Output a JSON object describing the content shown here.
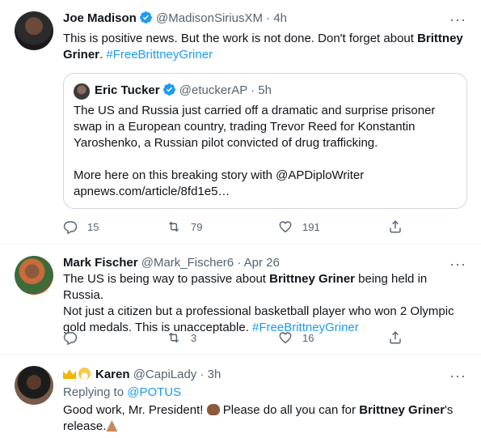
{
  "tweets": [
    {
      "name": "Joe Madison",
      "handle": "@MadisonSiriusXM",
      "time": "4h",
      "text_1": "This is positive news. But the work is not done. Don't forget about ",
      "text_bold_1": "Brittney",
      "text_bold_2": "Griner",
      "text_2": ". ",
      "hashtag": "#FreeBrittneyGriner",
      "quote": {
        "name": "Eric Tucker",
        "handle": "@etuckerAP",
        "time": "5h",
        "line_1": "The US and Russia just carried off a dramatic and surprise prisoner",
        "line_2": "swap in a European country, trading Trevor Reed for Konstantin",
        "line_3": "Yaroshenko, a Russian pilot convicted of drug trafficking.",
        "line_4": "More here on this breaking story with @APDiploWriter",
        "line_5": "apnews.com/article/8fd1e5…"
      },
      "replies": "15",
      "retweets": "79",
      "likes": "191"
    },
    {
      "name": "Mark Fischer",
      "handle": "@Mark_Fischer6",
      "time": "Apr 26",
      "line_1a": "The US is being way to passive about ",
      "line_1b": "Brittney Griner",
      "line_1c": " being held in Russia.",
      "line_2": "Not just a citizen but a professional basketball player who won 2 Olympic",
      "line_3": "gold medals. This is unacceptable. ",
      "hashtag": "#FreeBrittneyGriner",
      "replies": "",
      "retweets": "3",
      "likes": "16"
    },
    {
      "name": "Karen",
      "handle": "@CapiLady",
      "time": "3h",
      "replying_prefix": "Replying to ",
      "replying_to": "@POTUS",
      "line_1a": "Good work, Mr. President! ",
      "line_1b": " Please do all you can for ",
      "line_1c": "Brittney Griner",
      "line_1d": "'s",
      "line_2": "release."
    }
  ],
  "separator": "·",
  "more_label": "···",
  "icons": {
    "verified": "verified-badge-icon",
    "reply": "reply-icon",
    "retweet": "retweet-icon",
    "like": "heart-icon",
    "share": "share-icon"
  },
  "colors": {
    "link": "#1d9bf0",
    "muted": "#536471",
    "border": "#cfd9de"
  }
}
